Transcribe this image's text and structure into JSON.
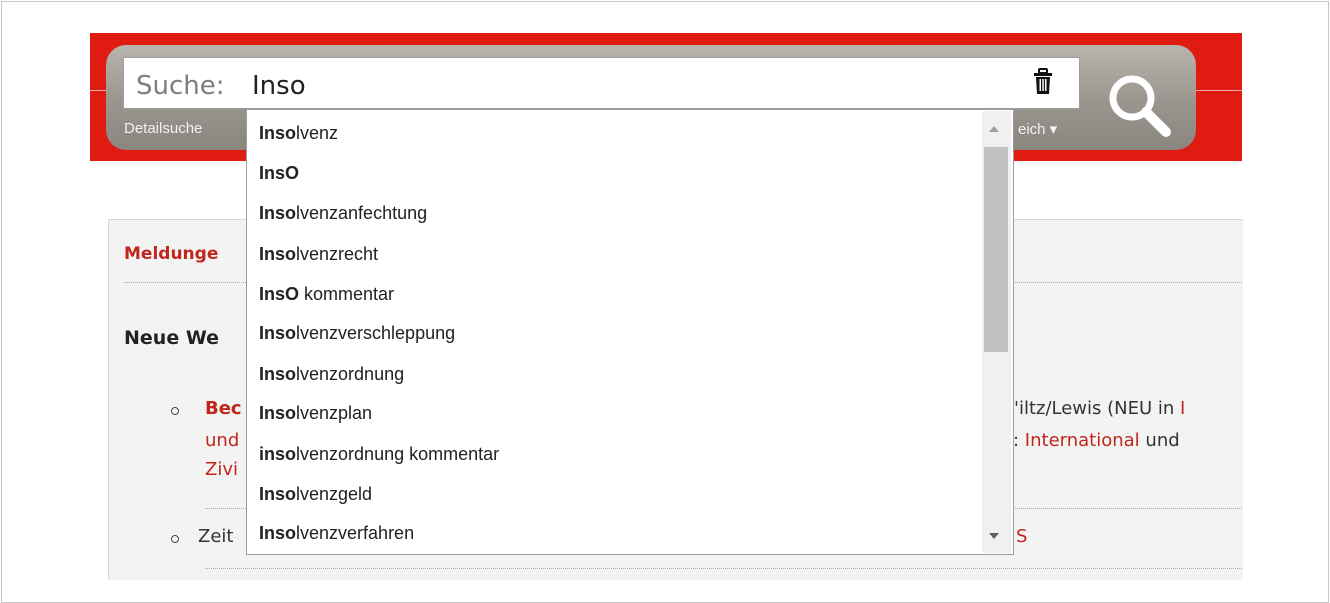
{
  "search": {
    "label": "Suche:",
    "value": "Inso",
    "detail_link": "Detailsuche",
    "area_link": "eich ▾"
  },
  "icons": {
    "trash": "trash-icon",
    "search": "magnifier-icon"
  },
  "suggestions": [
    {
      "bold": "Inso",
      "rest": "lvenz"
    },
    {
      "bold": "InsO",
      "rest": ""
    },
    {
      "bold": "Inso",
      "rest": "lvenzanfechtung"
    },
    {
      "bold": "Inso",
      "rest": "lvenzrecht"
    },
    {
      "bold": "InsO",
      "rest": " kommentar"
    },
    {
      "bold": "Inso",
      "rest": "lvenzverschleppung"
    },
    {
      "bold": "Inso",
      "rest": "lvenzordnung"
    },
    {
      "bold": "Inso",
      "rest": "lvenzplan"
    },
    {
      "bold": "inso",
      "rest": "lvenzordnung kommentar"
    },
    {
      "bold": "Inso",
      "rest": "lvenzgeld"
    },
    {
      "bold": "Inso",
      "rest": "lvenzverfahren"
    }
  ],
  "content": {
    "heading_fragment": "Meldunge",
    "section_fragment": "Neue We",
    "item1_line1_start": "Bec",
    "item1_line1_end_a": "'iltz/Lewis (NEU in ",
    "item1_line1_end_b": "I",
    "item1_line2_start": "und",
    "item1_line2_end_a": ": ",
    "item1_line2_end_link": "International",
    "item1_line2_end_b": " und",
    "item1_line3_start": "Zivi",
    "item2_start": "Zeit",
    "item2_end": "S"
  },
  "colors": {
    "brand_red": "#df1b12",
    "link_red": "#c0261c"
  }
}
